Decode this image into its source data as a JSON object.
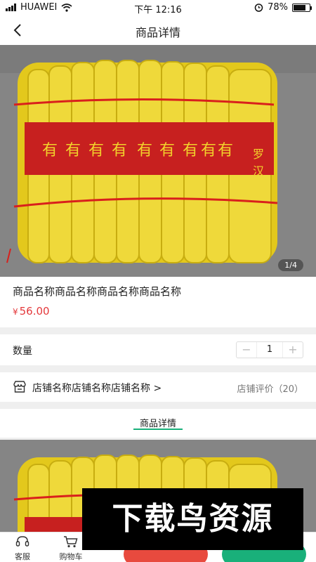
{
  "status_bar": {
    "carrier": "HUAWEI",
    "time": "下午 12:16",
    "battery": "78%",
    "battery_level": 0.78
  },
  "header": {
    "title": "商品详情"
  },
  "gallery": {
    "counter": "1/4",
    "label_glyph": "有",
    "label_tail": "罗汉"
  },
  "product": {
    "name": "商品名称商品名称商品名称商品名称",
    "currency": "¥",
    "price": "56.00"
  },
  "quantity": {
    "label": "数量",
    "minus": "−",
    "value": "1",
    "plus": "+"
  },
  "shop": {
    "name": "店铺名称店铺名称店铺名称 >",
    "rating": "店铺评价（20）"
  },
  "tabs": {
    "detail": "商品详情"
  },
  "bottom_bar": {
    "service": "客服",
    "cart": "购物车"
  },
  "watermark": {
    "text": "下载鸟资源"
  },
  "colors": {
    "accent_green": "#19b07a",
    "price_red": "#e4393c"
  }
}
